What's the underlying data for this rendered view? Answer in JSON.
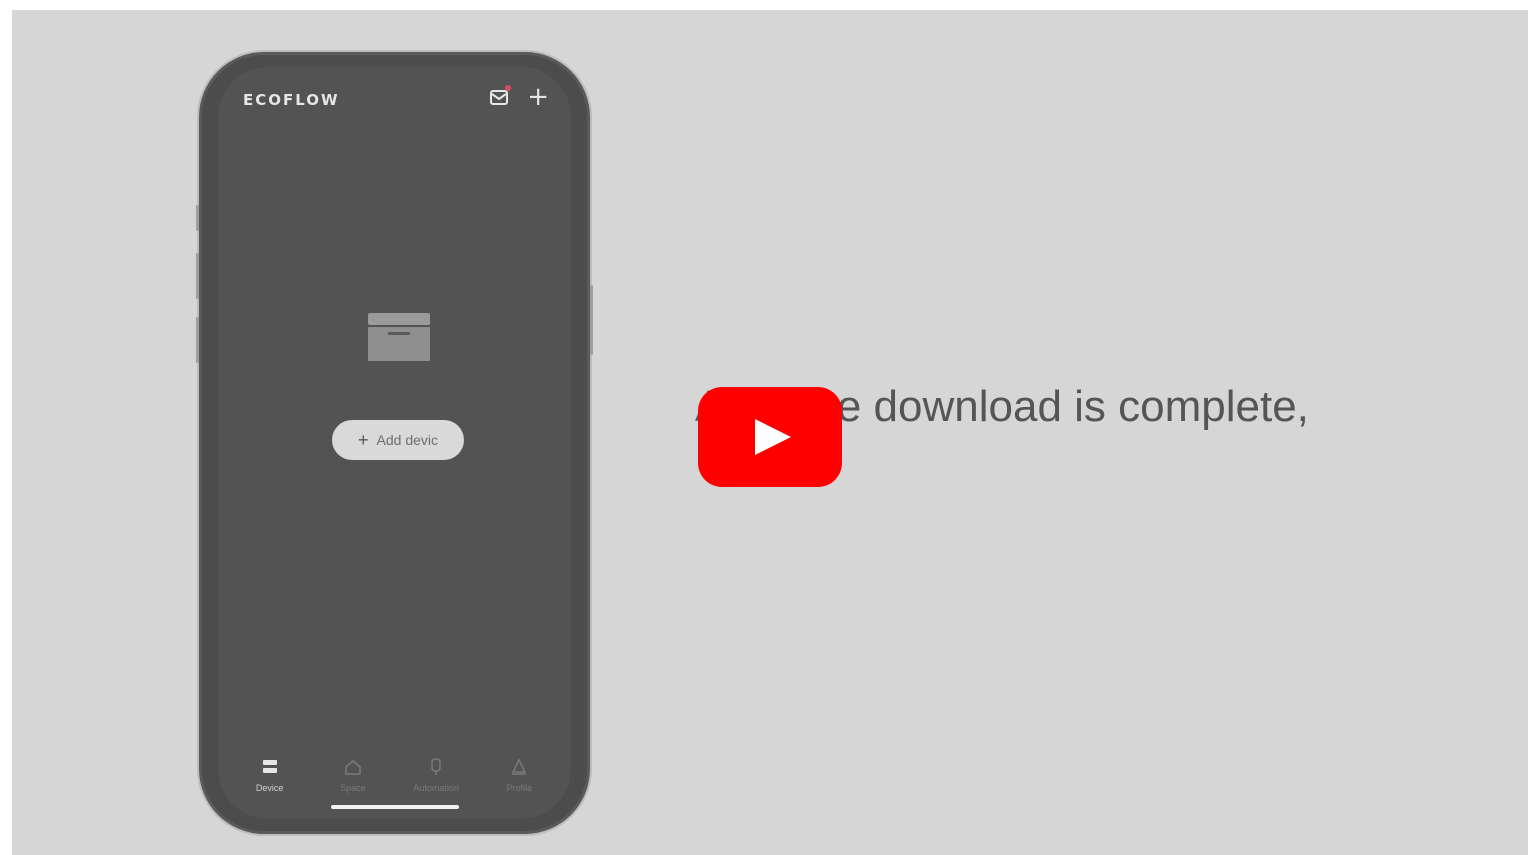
{
  "app": {
    "brand": "ECOFLOW",
    "add_device_label": "Add devic",
    "accent_color": "#e04a6a"
  },
  "tabs": [
    {
      "label": "Device",
      "icon": "device-icon",
      "active": true
    },
    {
      "label": "Space",
      "icon": "home-icon",
      "active": false
    },
    {
      "label": "Automation",
      "icon": "automation-icon",
      "active": false
    },
    {
      "label": "Profile",
      "icon": "profile-icon",
      "active": false
    }
  ],
  "video": {
    "caption": "After the download is complete,",
    "play_button_color": "#ff0000"
  }
}
